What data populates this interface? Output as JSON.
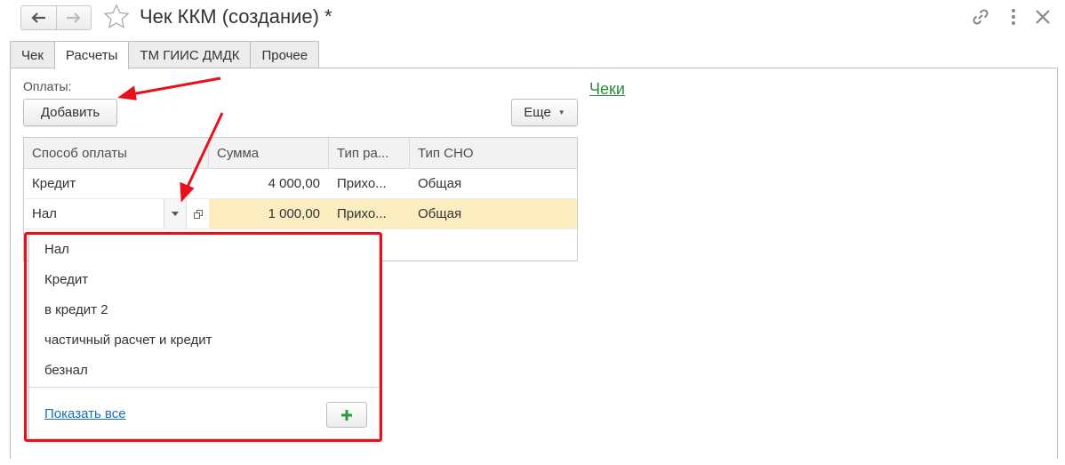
{
  "window": {
    "title": "Чек ККМ (создание) *",
    "icons": {
      "back": "arrow-left-icon",
      "forward": "arrow-right-icon",
      "favorite": "star-icon",
      "link": "link-icon",
      "menu": "kebab-menu-icon",
      "close": "close-icon"
    }
  },
  "tabs": [
    {
      "label": "Чек",
      "active": false
    },
    {
      "label": "Расчеты",
      "active": true
    },
    {
      "label": "ТМ ГИИС ДМДК",
      "active": false
    },
    {
      "label": "Прочее",
      "active": false
    }
  ],
  "payments": {
    "label": "Оплаты:",
    "add_button": "Добавить",
    "more_button": "Еще",
    "columns": [
      "Способ оплаты",
      "Сумма",
      "Тип ра...",
      "Тип СНО"
    ],
    "rows": [
      {
        "method": "Кредит",
        "amount": "4 000,00",
        "type": "Прихо...",
        "sno": "Общая",
        "selected": false
      },
      {
        "method": "Нал",
        "amount": "1 000,00",
        "type": "Прихо...",
        "sno": "Общая",
        "selected": true
      }
    ]
  },
  "checks_link": "Чеки",
  "dropdown": {
    "items": [
      "Нал",
      "Кредит",
      "в кредит 2",
      "частичный расчет и кредит",
      "безнал"
    ],
    "show_all": "Показать все",
    "add_icon": "plus-icon"
  },
  "colors": {
    "accent_green": "#2a8a3a",
    "link_blue": "#1a6fb5",
    "selected_row": "#fbedc0",
    "annotation_red": "#e8111b"
  }
}
